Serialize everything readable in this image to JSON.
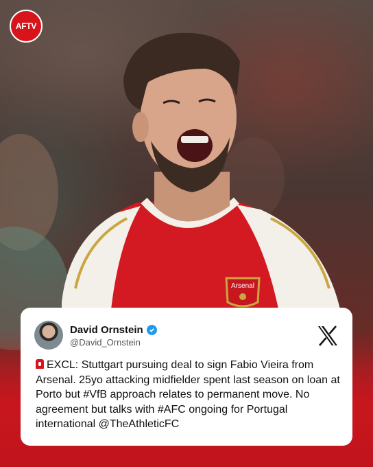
{
  "brand": {
    "logo_text": "AFTV"
  },
  "post": {
    "author_name": "David Ornstein",
    "author_handle": "@David_Ornstein",
    "platform_icon": "x-logo-icon",
    "alert_icon": "siren-icon",
    "text": "EXCL: Stuttgart pursuing deal to sign Fabio Vieira from Arsenal. 25yo attacking midfielder spent last season on loan at Porto but #VfB approach relates to permanent move. No agreement but talks with #AFC ongoing for Portugal international @TheAthleticFC"
  },
  "photo": {
    "shirt_badge": "Arsenal"
  },
  "colors": {
    "brand_red": "#c8161e",
    "verified_blue": "#1d9bf0"
  }
}
